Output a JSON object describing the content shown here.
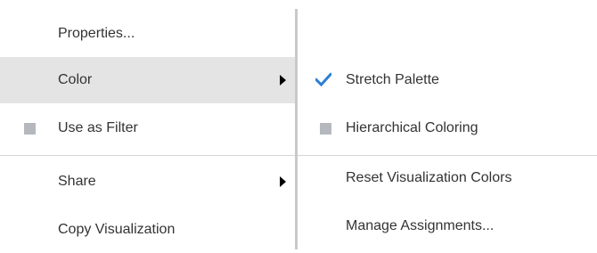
{
  "main_menu": {
    "items": [
      {
        "label": "Properties...",
        "icon": "",
        "submenu": false
      },
      {
        "label": "Color",
        "icon": "",
        "submenu": true,
        "highlighted": true
      },
      {
        "label": "Use as Filter",
        "icon": "filter-square-icon",
        "submenu": false
      },
      {
        "label": "Share",
        "icon": "",
        "submenu": true
      },
      {
        "label": "Copy Visualization",
        "icon": "",
        "submenu": false
      }
    ]
  },
  "color_submenu": {
    "items": [
      {
        "label": "Stretch Palette",
        "icon": "checkmark-icon",
        "checked": true
      },
      {
        "label": "Hierarchical Coloring",
        "icon": "square-icon",
        "checked": false
      },
      {
        "label": "Reset Visualization Colors",
        "icon": "",
        "checked": false
      },
      {
        "label": "Manage Assignments...",
        "icon": "",
        "checked": false
      }
    ]
  },
  "colors": {
    "highlight": "#e4e4e4",
    "checkmark": "#2a7fd4",
    "square_icon": "#b5b9be",
    "text": "#333333"
  }
}
